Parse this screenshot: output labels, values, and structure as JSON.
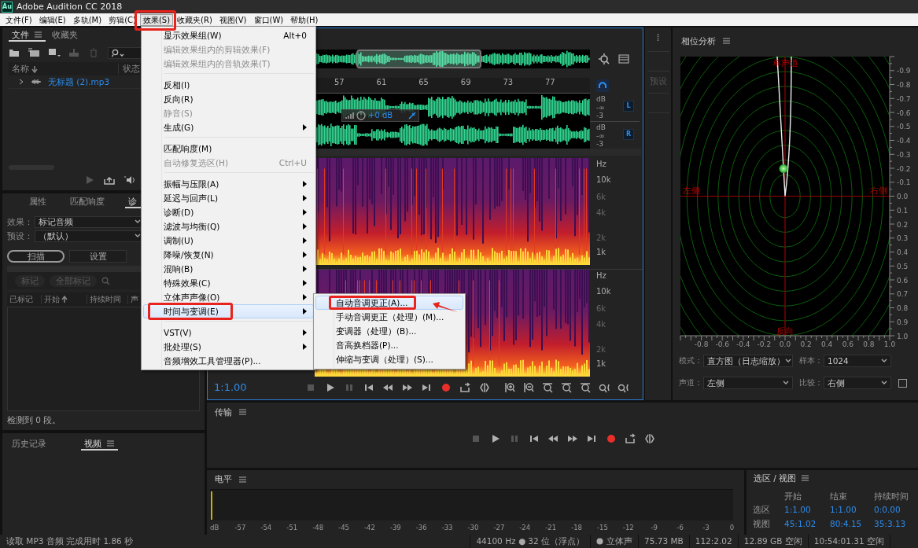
{
  "window": {
    "app_icon": "Au",
    "title": "Adobe Audition CC 2018"
  },
  "menu_bar": [
    {
      "label": "文件(F)",
      "selected": false,
      "annotated": false
    },
    {
      "label": "编辑(E)",
      "selected": false,
      "annotated": false
    },
    {
      "label": "多轨(M)",
      "selected": false,
      "annotated": false
    },
    {
      "label": "剪辑(C)",
      "selected": false,
      "annotated": false
    },
    {
      "label": "效果(S)",
      "selected": true,
      "annotated": true
    },
    {
      "label": "收藏夹(R)",
      "selected": false,
      "annotated": false
    },
    {
      "label": "视图(V)",
      "selected": false,
      "annotated": false
    },
    {
      "label": "窗口(W)",
      "selected": false,
      "annotated": false
    },
    {
      "label": "帮助(H)",
      "selected": false,
      "annotated": false
    }
  ],
  "effects_menu": [
    {
      "kind": "item",
      "label": "显示效果组(W)",
      "shortcut": "Alt+0",
      "disabled": false,
      "submenu": false,
      "selected": false,
      "annotated": false
    },
    {
      "kind": "item",
      "label": "编辑效果组内的剪辑效果(F)",
      "disabled": true,
      "submenu": false,
      "selected": false,
      "annotated": false
    },
    {
      "kind": "item",
      "label": "编辑效果组内的音轨效果(T)",
      "disabled": true,
      "submenu": false,
      "selected": false,
      "annotated": false
    },
    {
      "kind": "separator"
    },
    {
      "kind": "item",
      "label": "反相(I)",
      "disabled": false,
      "submenu": false,
      "selected": false,
      "annotated": false
    },
    {
      "kind": "item",
      "label": "反向(R)",
      "disabled": false,
      "submenu": false,
      "selected": false,
      "annotated": false
    },
    {
      "kind": "item",
      "label": "静音(S)",
      "disabled": true,
      "submenu": false,
      "selected": false,
      "annotated": false
    },
    {
      "kind": "item",
      "label": "生成(G)",
      "disabled": false,
      "submenu": true,
      "selected": false,
      "annotated": false
    },
    {
      "kind": "separator"
    },
    {
      "kind": "item",
      "label": "匹配响度(M)",
      "disabled": false,
      "submenu": false,
      "selected": false,
      "annotated": false
    },
    {
      "kind": "item",
      "label": "自动修复选区(H)",
      "shortcut": "Ctrl+U",
      "disabled": true,
      "submenu": false,
      "selected": false,
      "annotated": false
    },
    {
      "kind": "separator"
    },
    {
      "kind": "item",
      "label": "振幅与压限(A)",
      "disabled": false,
      "submenu": true,
      "selected": false,
      "annotated": false
    },
    {
      "kind": "item",
      "label": "延迟与回声(L)",
      "disabled": false,
      "submenu": true,
      "selected": false,
      "annotated": false
    },
    {
      "kind": "item",
      "label": "诊断(D)",
      "disabled": false,
      "submenu": true,
      "selected": false,
      "annotated": false
    },
    {
      "kind": "item",
      "label": "滤波与均衡(Q)",
      "disabled": false,
      "submenu": true,
      "selected": false,
      "annotated": false
    },
    {
      "kind": "item",
      "label": "调制(U)",
      "disabled": false,
      "submenu": true,
      "selected": false,
      "annotated": false
    },
    {
      "kind": "item",
      "label": "降噪/恢复(N)",
      "disabled": false,
      "submenu": true,
      "selected": false,
      "annotated": false
    },
    {
      "kind": "item",
      "label": "混响(B)",
      "disabled": false,
      "submenu": true,
      "selected": false,
      "annotated": false
    },
    {
      "kind": "item",
      "label": "特殊效果(C)",
      "disabled": false,
      "submenu": true,
      "selected": false,
      "annotated": false
    },
    {
      "kind": "item",
      "label": "立体声声像(O)",
      "disabled": false,
      "submenu": true,
      "selected": false,
      "annotated": false
    },
    {
      "kind": "item",
      "label": "时间与变调(E)",
      "disabled": false,
      "submenu": true,
      "selected": true,
      "annotated": true
    },
    {
      "kind": "separator"
    },
    {
      "kind": "item",
      "label": "VST(V)",
      "disabled": false,
      "submenu": true,
      "selected": false,
      "annotated": false
    },
    {
      "kind": "item",
      "label": "批处理(S)",
      "disabled": false,
      "submenu": true,
      "selected": false,
      "annotated": false
    },
    {
      "kind": "item",
      "label": "音频增效工具管理器(P)...",
      "disabled": false,
      "submenu": false,
      "selected": false,
      "annotated": false
    }
  ],
  "effects_submenu": [
    {
      "label": "自动音调更正(A)...",
      "selected": true,
      "annotated": true
    },
    {
      "label": "手动音调更正（处理）(M)...",
      "selected": false,
      "annotated": false
    },
    {
      "label": "变调器（处理）(B)...",
      "selected": false,
      "annotated": false
    },
    {
      "label": "音高换档器(P)...",
      "selected": false,
      "annotated": false
    },
    {
      "label": "伸缩与变调（处理）(S)...",
      "selected": false,
      "annotated": false
    }
  ],
  "files_panel": {
    "tabs": [
      {
        "label": "文件",
        "selected": true
      },
      {
        "label": "收藏夹",
        "selected": false
      }
    ],
    "columns": [
      "名称",
      "状态"
    ],
    "files": [
      {
        "name": "无标题 (2).mp3",
        "expanded": false
      }
    ]
  },
  "diagnostics_panel": {
    "tabs": [
      {
        "label": "属性",
        "selected": false
      },
      {
        "label": "匹配响度",
        "selected": false
      },
      {
        "label": "诊",
        "selected": true
      }
    ],
    "fields": [
      {
        "label": "效果：",
        "value": "标记音频"
      },
      {
        "label": "预设：",
        "value": "（默认）"
      }
    ],
    "buttons": [
      {
        "label": "扫描",
        "focused": true
      },
      {
        "label": "设置",
        "focused": false
      }
    ],
    "marker_buttons": [
      {
        "label": "标记",
        "disabled": true
      },
      {
        "label": "全部标记",
        "disabled": true
      }
    ],
    "columns": [
      "已标记",
      "开始",
      "持续时间",
      "声"
    ],
    "status": "检测到 0 段。"
  },
  "history_panel": {
    "tabs": [
      {
        "label": "历史记录",
        "selected": false
      },
      {
        "label": "视频",
        "selected": true
      }
    ]
  },
  "editor": {
    "ruler": [
      "57",
      "61",
      "65",
      "69",
      "73",
      "77"
    ],
    "channels": [
      {
        "label": "L",
        "scale": [
          "dB",
          "-∞",
          "-3"
        ]
      },
      {
        "label": "R",
        "scale": [
          "dB",
          "-∞",
          "-3"
        ]
      }
    ],
    "gain_hud": "+0 dB",
    "spectra": [
      {
        "scale": [
          "Hz",
          "10k",
          "6k",
          "4k",
          "2k",
          "1k"
        ]
      },
      {
        "scale": [
          "Hz",
          "10k",
          "6k",
          "4k",
          "2k",
          "1k"
        ]
      }
    ],
    "time": "1:1.00"
  },
  "side_tabs": [
    "预设"
  ],
  "phase_panel": {
    "title": "相位分析",
    "labels": {
      "top": "单声道",
      "left": "左侧",
      "right": "右侧",
      "bottom": "反向"
    },
    "y_ticks": [
      "-0.9",
      "-0.8",
      "-0.7",
      "-0.6",
      "-0.5",
      "-0.4",
      "-0.3",
      "-0.2",
      "-0.1",
      "0.0",
      "0.1",
      "0.2",
      "0.3",
      "0.4",
      "0.5",
      "0.6",
      "0.7",
      "0.8",
      "0.9",
      "1.0"
    ],
    "x_ticks": [
      "-0.8",
      "-0.6",
      "-0.4",
      "-0.2",
      "0.0",
      "0.2",
      "0.4",
      "0.6",
      "0.8",
      "1.0"
    ],
    "controls": [
      {
        "label": "模式：",
        "value": "直方图（日志缩放）"
      },
      {
        "label": "样本：",
        "value": "1024"
      },
      {
        "label": "声道：",
        "value": "左侧"
      },
      {
        "label": "比较：",
        "value": "右侧"
      }
    ],
    "checkbox": {
      "checked": false
    }
  },
  "transport_panel": {
    "title": "传输"
  },
  "level_panel": {
    "title": "电平",
    "scale": [
      "dB",
      "-57",
      "-54",
      "-51",
      "-48",
      "-45",
      "-42",
      "-39",
      "-36",
      "-33",
      "-30",
      "-27",
      "-24",
      "-21",
      "-18",
      "-15",
      "-12",
      "-9",
      "-6",
      "-3",
      "0"
    ]
  },
  "selection_panel": {
    "title": "选区 / 视图",
    "columns": [
      "开始",
      "结束",
      "持续时间"
    ],
    "rows": [
      {
        "label": "选区",
        "values": [
          "1:1.00",
          "1:1.00",
          "0:0.00"
        ]
      },
      {
        "label": "视图",
        "values": [
          "45:1.02",
          "80:4.15",
          "35:3.13"
        ]
      }
    ]
  },
  "status_bar": {
    "message": "读取 MP3 音频 完成用时 1.86 秒",
    "items": [
      "44100 Hz ● 32 位（浮点）",
      "立体声",
      "75.73 MB",
      "112:2.02",
      "12.89 GB 空闲",
      "10:54:01.31 空闲"
    ]
  }
}
